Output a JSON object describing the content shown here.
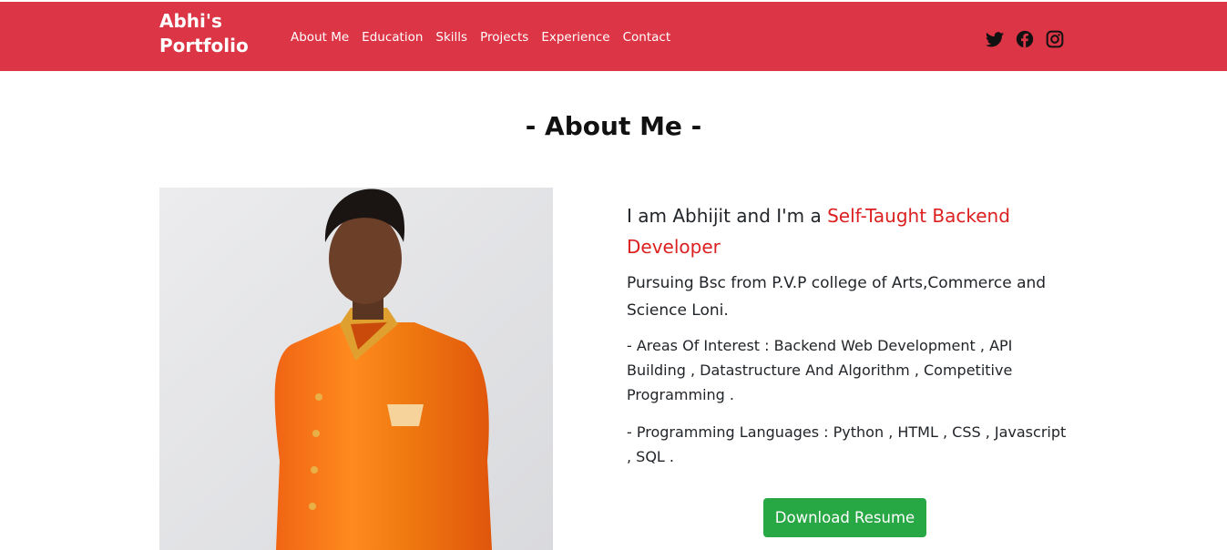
{
  "navbar": {
    "brand": "Abhi's Portfolio",
    "links": [
      {
        "label": "About Me"
      },
      {
        "label": "Education"
      },
      {
        "label": "Skills"
      },
      {
        "label": "Projects"
      },
      {
        "label": "Experience"
      },
      {
        "label": "Contact"
      }
    ],
    "social_icons": [
      "twitter-icon",
      "facebook-icon",
      "instagram-icon"
    ],
    "background_color": "#dc3545"
  },
  "about": {
    "title": "- About Me -",
    "intro_prefix": "I am Abhijit and I'm a ",
    "intro_highlight": "Self-Taught Backend Developer",
    "education": "Pursuing Bsc from P.V.P college of Arts,Commerce and Science Loni.",
    "interests": "- Areas Of Interest : Backend Web Development , API Building , Datastructure And Algorithm , Competitive Programming .",
    "languages": "- Programming Languages : Python , HTML , CSS , Javascript , SQL .",
    "download_button": "Download Resume",
    "highlight_color": "#dc1f1f",
    "button_color": "#28a745"
  }
}
